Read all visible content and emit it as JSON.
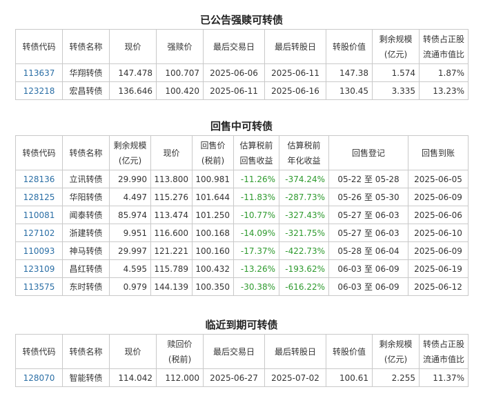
{
  "forced_redemption": {
    "title": "已公告强赎可转债",
    "headers": [
      "转债代码",
      "转债名称",
      "现价",
      "强赎价",
      "最后交易日",
      "最后转股日",
      "转股价值",
      "剩余规模\n(亿元)",
      "转债占正股\n流通市值比"
    ],
    "rows": [
      [
        "113637",
        "华翔转债",
        "147.478",
        "100.707",
        "2025-06-06",
        "2025-06-11",
        "147.38",
        "1.574",
        "1.87%"
      ],
      [
        "123218",
        "宏昌转债",
        "136.646",
        "100.420",
        "2025-06-11",
        "2025-06-16",
        "130.45",
        "3.335",
        "13.23%"
      ]
    ]
  },
  "putback": {
    "title": "回售中可转债",
    "headers": [
      "转债代码",
      "转债名称",
      "剩余规模\n(亿元)",
      "现价",
      "回售价\n(税前)",
      "估算税前\n回售收益",
      "估算税前\n年化收益",
      "回售登记",
      "回售到账"
    ],
    "rows": [
      [
        "128136",
        "立讯转债",
        "29.990",
        "113.800",
        "100.981",
        "-11.26%",
        "-374.24%",
        "05-22 至 05-28",
        "2025-06-05"
      ],
      [
        "128125",
        "华阳转债",
        "4.497",
        "115.276",
        "101.644",
        "-11.83%",
        "-287.73%",
        "05-26 至 05-30",
        "2025-06-09"
      ],
      [
        "110081",
        "闻泰转债",
        "85.974",
        "113.474",
        "101.250",
        "-10.77%",
        "-327.43%",
        "05-27 至 06-03",
        "2025-06-06"
      ],
      [
        "127102",
        "浙建转债",
        "9.951",
        "116.600",
        "100.168",
        "-14.09%",
        "-321.75%",
        "05-27 至 06-03",
        "2025-06-10"
      ],
      [
        "110093",
        "神马转债",
        "29.997",
        "121.221",
        "100.160",
        "-17.37%",
        "-422.73%",
        "05-28 至 06-04",
        "2025-06-09"
      ],
      [
        "123109",
        "昌红转债",
        "4.595",
        "115.789",
        "100.432",
        "-13.26%",
        "-193.62%",
        "06-03 至 06-09",
        "2025-06-19"
      ],
      [
        "113575",
        "东时转债",
        "0.979",
        "144.139",
        "100.350",
        "-30.38%",
        "-616.22%",
        "06-03 至 06-09",
        "2025-06-12"
      ]
    ]
  },
  "maturity": {
    "title": "临近到期可转债",
    "headers": [
      "转债代码",
      "转债名称",
      "现价",
      "赎回价\n(税前)",
      "最后交易日",
      "最后转股日",
      "转股价值",
      "剩余规模\n(亿元)",
      "转债占正股\n流通市值比"
    ],
    "rows": [
      [
        "128070",
        "智能转债",
        "114.042",
        "112.000",
        "2025-06-27",
        "2025-07-02",
        "100.61",
        "2.255",
        "11.37%"
      ]
    ]
  },
  "colors": {
    "code_link": "#2a6ea5",
    "negative": "#2e9a2e",
    "border": "#c9c9c9"
  }
}
